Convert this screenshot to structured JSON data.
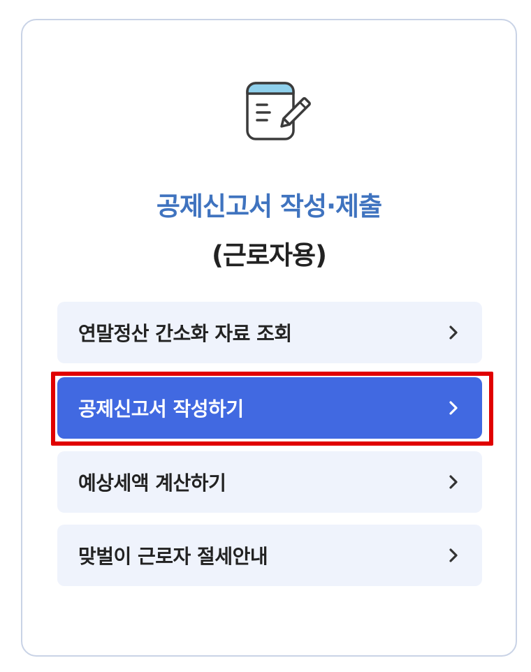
{
  "card": {
    "title": "공제신고서 작성·제출",
    "subtitle": "(근로자용)",
    "icon": "notepad-pencil-icon"
  },
  "menu": [
    {
      "label": "연말정산 간소화 자료 조회",
      "icon": "chevron-right-icon",
      "active": false
    },
    {
      "label": "공제신고서 작성하기",
      "icon": "chevron-right-icon",
      "active": true
    },
    {
      "label": "예상세액 계산하기",
      "icon": "chevron-right-icon",
      "active": false
    },
    {
      "label": "맞벌이 근로자 절세안내",
      "icon": "chevron-right-icon",
      "active": false
    }
  ],
  "colors": {
    "title": "#3f73bf",
    "active_bg": "#4169e1",
    "item_bg": "#eff3fc",
    "highlight": "#e00000",
    "card_border": "#c9d3e6"
  }
}
